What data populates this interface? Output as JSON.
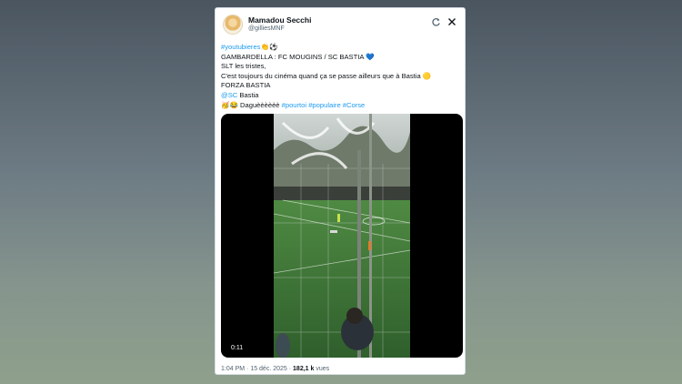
{
  "tweet": {
    "author_name": "Mamadou Secchi",
    "author_handle": "@gilliesMNF",
    "lines": {
      "l1_tag": "#youtubieres",
      "l1_emoji": "👏⚽",
      "l2": "GAMBARDELLA : FC MOUGINS / SC BASTIA 💙",
      "l3": "SLT les tristes,",
      "l4": "C'est toujours du cinéma quand ça se passe ailleurs que à Bastia 🟡",
      "l5": "FORZA BASTIA",
      "l6_mention": "@SC",
      "l6_text": " Bastia",
      "l7_text": "🥳😂 Daguèèèèèè ",
      "l7_tag1": "#pourtoi",
      "l7_tag2": "#populaire",
      "l7_tag3": "#Corse"
    },
    "video": {
      "duration": "0:11"
    },
    "meta": {
      "time": "1:04 PM",
      "sep": " · ",
      "date": "15 déc. 2025",
      "sep2": " · ",
      "views_count": "182,1 k",
      "views_label": " vues"
    }
  },
  "icons": {
    "refresh": "grok-icon",
    "close": "close-icon"
  },
  "colors": {
    "link": "#1d9bf0",
    "pitch": "#3f7d3a"
  }
}
